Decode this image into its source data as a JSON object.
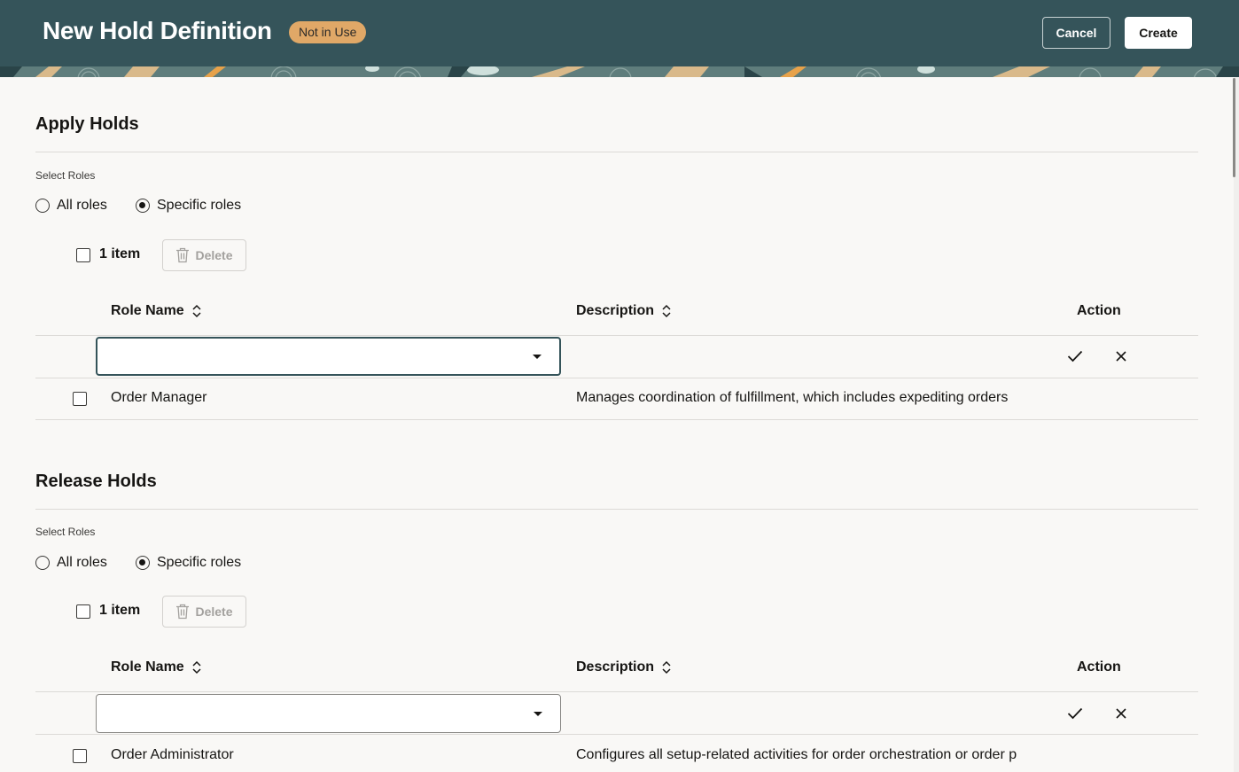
{
  "header": {
    "title": "New Hold Definition",
    "status_badge": "Not in Use",
    "cancel_label": "Cancel",
    "create_label": "Create"
  },
  "apply_holds": {
    "title": "Apply Holds",
    "select_roles_label": "Select Roles",
    "radio_all": "All roles",
    "radio_specific": "Specific roles",
    "selected_option": "Specific roles",
    "item_count": "1 item",
    "delete_label": "Delete",
    "columns": {
      "role_name": "Role Name",
      "description": "Description",
      "action": "Action"
    },
    "new_row_value": "",
    "rows": [
      {
        "role_name": "Order Manager",
        "description": "Manages coordination of fulfillment, which includes expediting orders"
      }
    ]
  },
  "release_holds": {
    "title": "Release Holds",
    "select_roles_label": "Select Roles",
    "radio_all": "All roles",
    "radio_specific": "Specific roles",
    "selected_option": "Specific roles",
    "item_count": "1 item",
    "delete_label": "Delete",
    "columns": {
      "role_name": "Role Name",
      "description": "Description",
      "action": "Action"
    },
    "new_row_value": "",
    "rows": [
      {
        "role_name": "Order Administrator",
        "description": "Configures all setup-related activities for order orchestration or order p"
      }
    ]
  },
  "colors": {
    "header_bg": "#35545a",
    "badge_bg": "#e0a867",
    "page_bg": "#f9f8f6"
  }
}
